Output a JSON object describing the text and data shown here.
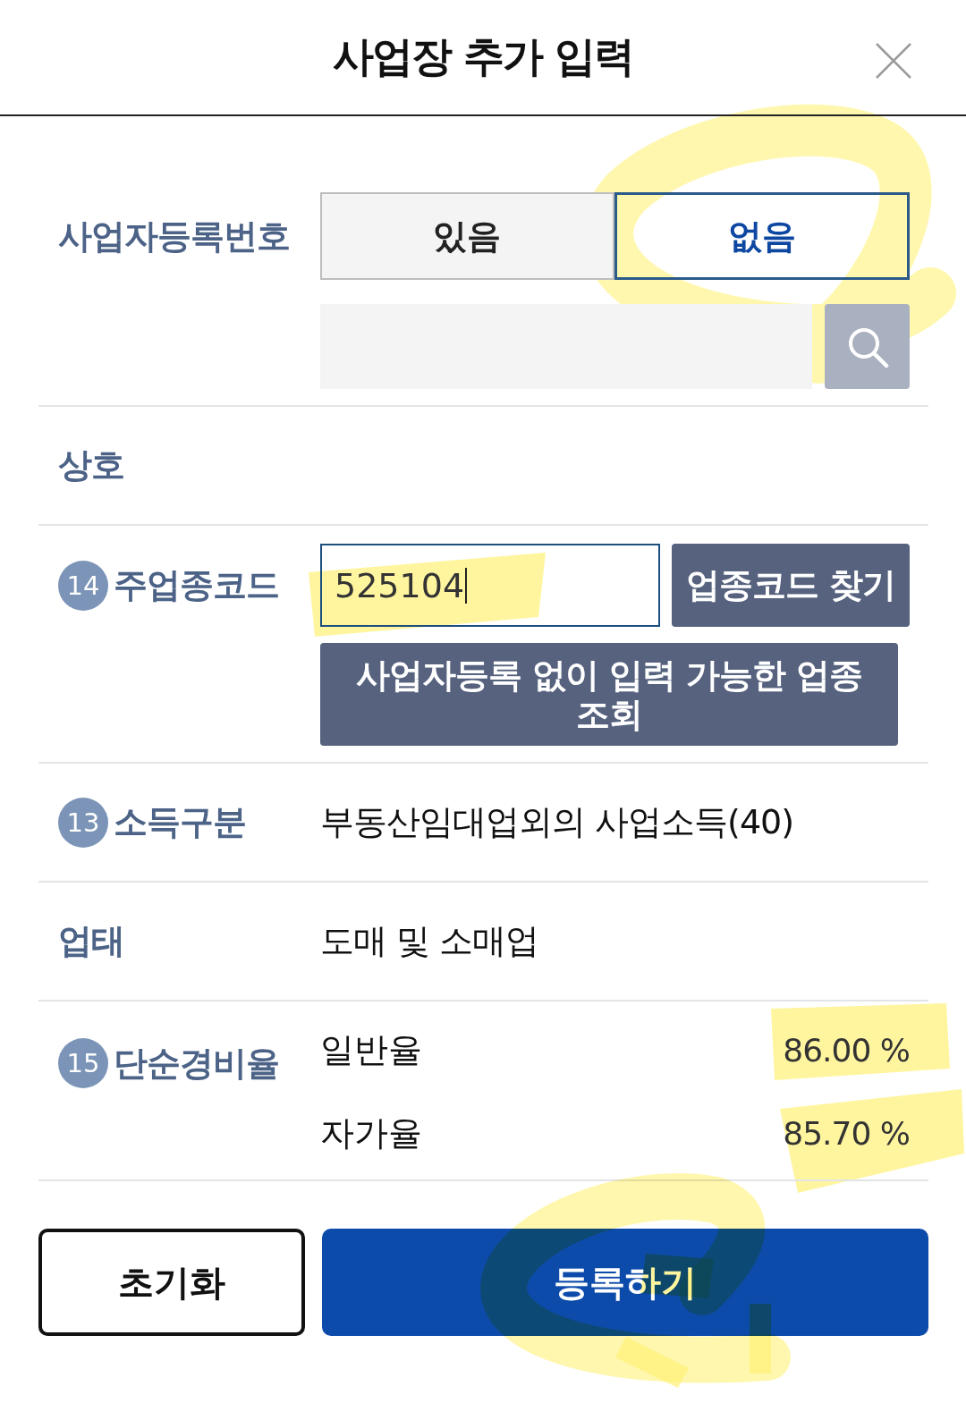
{
  "dialog": {
    "title": "사업장 추가 입력"
  },
  "fields": [
    {
      "kind": "toggle_search",
      "label": "사업자등록번호",
      "options": [
        {
          "label": "있음",
          "selected": false
        },
        {
          "label": "없음",
          "selected": true
        }
      ]
    },
    {
      "kind": "text",
      "label": "상호"
    },
    {
      "kind": "code",
      "badge": "14",
      "label": "주업종코드",
      "value": "525104",
      "focused": true,
      "buttons": [
        "업종코드 찾기",
        "사업자등록 없이 입력 가능한 업종 조회"
      ]
    },
    {
      "kind": "text",
      "badge": "13",
      "label": "소득구분",
      "value": "부동산임대업외의 사업소득(40)"
    },
    {
      "kind": "text",
      "label": "업태",
      "value": "도매 및 소매업"
    },
    {
      "kind": "rates",
      "badge": "15",
      "label": "단순경비율",
      "rates": [
        {
          "name": "일반율",
          "value": "86.00 %"
        },
        {
          "name": "자가율",
          "value": "85.70 %"
        }
      ]
    }
  ],
  "actions": [
    {
      "kind": "secondary",
      "label": "초기화"
    },
    {
      "kind": "primary",
      "label": "등록하기"
    }
  ]
}
